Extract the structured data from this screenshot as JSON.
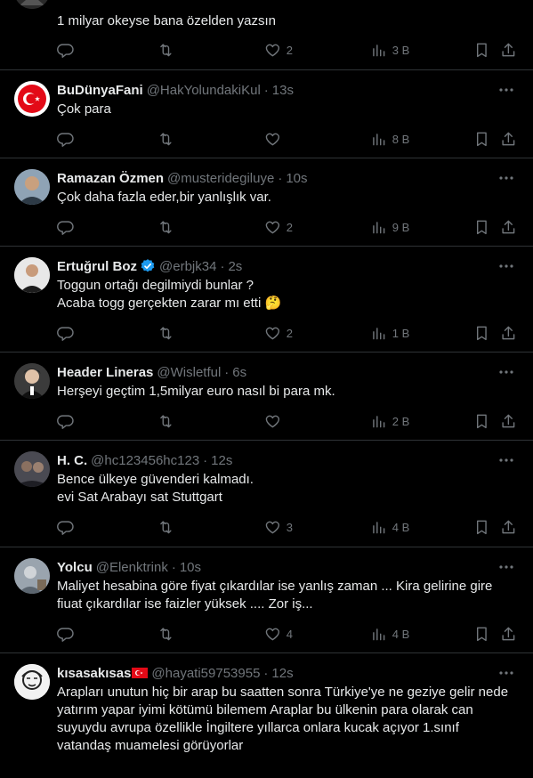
{
  "tweets": [
    {
      "name": "",
      "handle": "",
      "time": "",
      "lines": [
        "1 milyar okeyse bana özelden yazsın"
      ],
      "replies": "",
      "retweets": "",
      "likes": "2",
      "views": "3 B"
    },
    {
      "name": "BuDünyaFani",
      "handle": "@HakYolundakiKul",
      "time": "13s",
      "lines": [
        "Çok para"
      ],
      "replies": "",
      "retweets": "",
      "likes": "",
      "views": "8 B"
    },
    {
      "name": "Ramazan Özmen",
      "handle": "@musteridegiluye",
      "time": "10s",
      "lines": [
        "Çok daha fazla eder,bir yanlışlık var."
      ],
      "replies": "",
      "retweets": "",
      "likes": "2",
      "views": "9 B"
    },
    {
      "name": "Ertuğrul Boz",
      "handle": "@erbjk34",
      "time": "2s",
      "lines": [
        "Toggun ortağı degilmiydi bunlar ?",
        "Acaba togg gerçekten zarar mı etti 🤔"
      ],
      "replies": "",
      "retweets": "",
      "likes": "2",
      "views": "1 B",
      "verified": true
    },
    {
      "name": "Header Lineras",
      "handle": "@Wisletful",
      "time": "6s",
      "lines": [
        "Herşeyi geçtim 1,5milyar euro nasıl bi para mk."
      ],
      "replies": "",
      "retweets": "",
      "likes": "",
      "views": "2 B"
    },
    {
      "name": "H. C.",
      "handle": "@hc123456hc123",
      "time": "12s",
      "lines": [
        "Bence ülkeye güvenderi kalmadı.",
        "evi Sat Arabayı sat Stuttgart"
      ],
      "replies": "",
      "retweets": "",
      "likes": "3",
      "views": "4 B"
    },
    {
      "name": "Yolcu",
      "handle": "@Elenktrink",
      "time": "10s",
      "lines": [
        "Maliyet hesabina göre fiyat çıkardılar ise yanlış zaman ... Kira gelirine gire",
        "fiuat çıkardılar ise faizler yüksek .... Zor iş..."
      ],
      "replies": "",
      "retweets": "",
      "likes": "4",
      "views": "4 B"
    },
    {
      "name": "kısasakısas",
      "handle": "@hayati59753955",
      "time": "12s",
      "lines": [
        "Arapları unutun hiç bir arap bu saatten sonra Türkiye'ye ne geziye gelir nede",
        "yatırım yapar iyimi kötümü bilemem Araplar bu ülkenin para olarak can",
        "suyuydu avrupa özellikle İngiltere yıllarca onlara kucak açıyor 1.sınıf",
        "vatandaş muamelesi görüyorlar"
      ],
      "replies": "",
      "retweets": "",
      "likes": "",
      "views": "",
      "flag": "turkey-flag"
    }
  ],
  "colors": {
    "bg": "#000000",
    "text": "#e7e9ea",
    "muted": "#71767b",
    "border": "#2f3336",
    "verified": "#1d9bf0"
  }
}
